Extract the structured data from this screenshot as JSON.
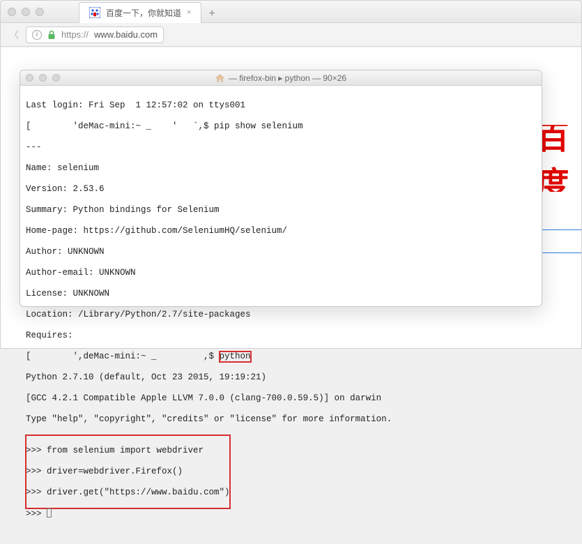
{
  "browser": {
    "tab_title": "百度一下，你就知道",
    "tab_close": "×",
    "new_tab": "+",
    "nav_back": "〈",
    "info_glyph": "i",
    "url_scheme": "https://",
    "url_host": "www.baidu.com",
    "baidu_cn": "百度"
  },
  "terminal": {
    "title": " — firefox-bin ▸ python — 90×26",
    "lines": {
      "l0": "Last login: Fri Sep  1 12:57:02 on ttys001",
      "l1_a": "[        'deMac-mini:~ _    '   `,$ pip show selenium",
      "l2": "---",
      "l3": "Name: selenium",
      "l4": "Version: 2.53.6",
      "l5": "Summary: Python bindings for Selenium",
      "l6": "Home-page: https://github.com/SeleniumHQ/selenium/",
      "l7": "Author: UNKNOWN",
      "l8": "Author-email: UNKNOWN",
      "l9": "License: UNKNOWN",
      "l10": "Location: /Library/Python/2.7/site-packages",
      "l11": "Requires:",
      "l12_a": "[        ',deMac-mini:~ _         ,$ ",
      "l12_b": "python",
      "l13": "Python 2.7.10 (default, Oct 23 2015, 19:19:21)",
      "l14": "[GCC 4.2.1 Compatible Apple LLVM 7.0.0 (clang-700.0.59.5)] on darwin",
      "l15": "Type \"help\", \"copyright\", \"credits\" or \"license\" for more information.",
      "p1_pre": ">>> ",
      "p1": "from selenium import webdriver",
      "p2": "driver=webdriver.Firefox()",
      "p3": "driver.get(\"https://www.baidu.com\")",
      "p4_pre": ">>> "
    }
  }
}
